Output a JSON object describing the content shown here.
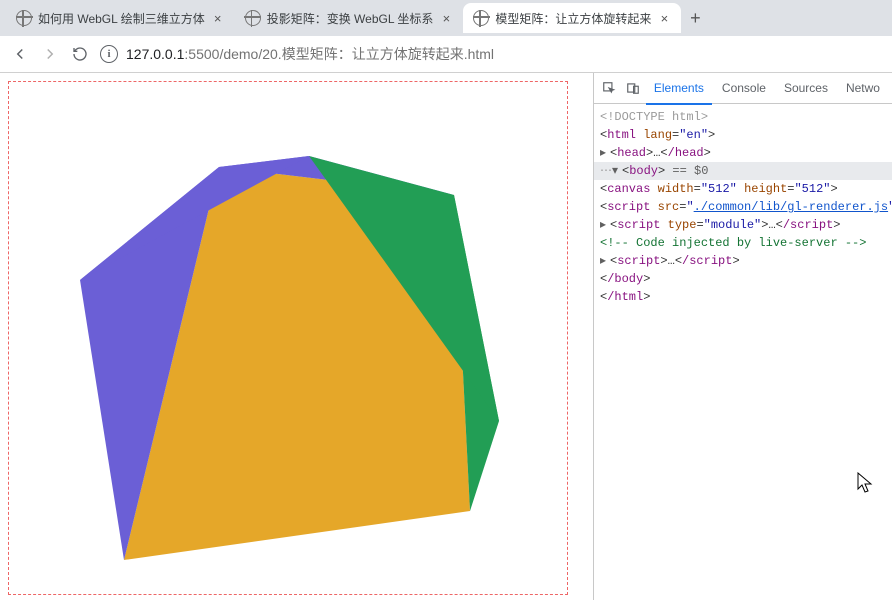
{
  "tabs": [
    {
      "title": "如何用 WebGL 绘制三维立方体"
    },
    {
      "title": "投影矩阵：变换 WebGL 坐标系"
    },
    {
      "title": "模型矩阵：让立方体旋转起来"
    }
  ],
  "url": {
    "info_icon": "i",
    "host": "127.0.0.1",
    "port": ":5500",
    "path": "/demo/20.模型矩阵：让立方体旋转起来.html"
  },
  "devtools": {
    "tabs": [
      "Elements",
      "Console",
      "Sources",
      "Netwo"
    ],
    "sel_annot": "== $0"
  },
  "dom": {
    "doctype": "<!DOCTYPE html>",
    "html_open": "html",
    "html_lang_attr": "lang",
    "html_lang_val": "\"en\"",
    "head_open": "head",
    "head_ellipsis": "…",
    "head_close": "/head",
    "body_open": "body",
    "canvas": "canvas",
    "width_attr": "width",
    "width_val": "\"512\"",
    "height_attr": "height",
    "height_val": "\"512\"",
    "script": "script",
    "src_attr": "src",
    "src_val": "./common/lib/gl-renderer.js",
    "type_attr": "type",
    "type_val": "\"module\"",
    "script_ellipsis": "…",
    "script_close": "/script",
    "comment": "<!-- Code injected by live-server -->",
    "body_close": "/body",
    "html_close": "/html"
  },
  "cube": {
    "top_color": "#6b5fd6",
    "front_color": "#e5a729",
    "right_color": "#229e55"
  }
}
